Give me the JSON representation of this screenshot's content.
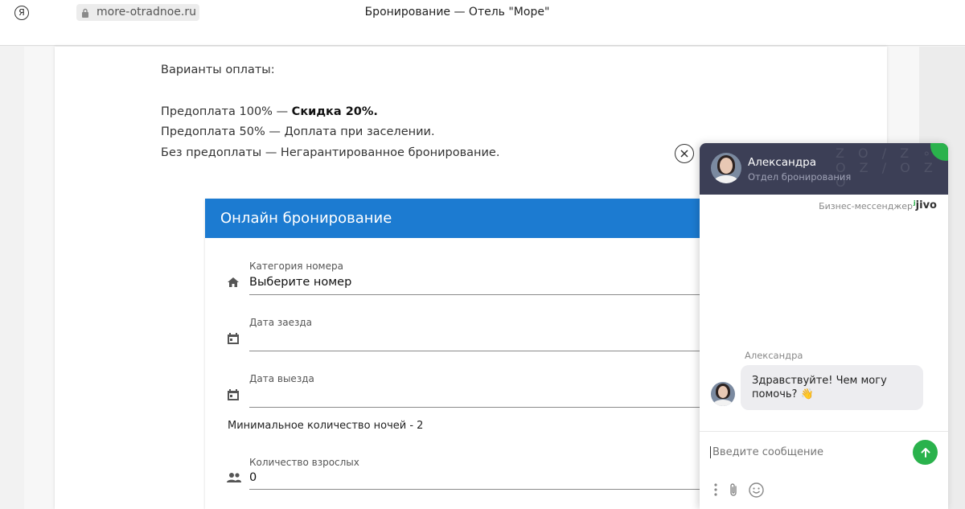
{
  "browser": {
    "logo": "Я",
    "url": "more-otradnoe.ru",
    "title": "Бронирование — Отель \"Море\""
  },
  "payment": {
    "heading": "Варианты оплаты:",
    "line1_prefix": "Предоплата 100% — ",
    "line1_bold": "Скидка 20%.",
    "line2": "Предоплата 50% — Доплата при заселении.",
    "line3": "Без предоплаты — Негарантированное бронирование."
  },
  "booking": {
    "title": "Онлайн бронирование",
    "room_label": "Категория номера",
    "room_value": "Выберите номер",
    "checkin_label": "Дата заезда",
    "checkin_value": "",
    "checkout_label": "Дата выезда",
    "checkout_value": "",
    "min_nights": "Минимальное количество ночей - 2",
    "adults_label": "Количество взрослых",
    "adults_value": "0"
  },
  "chat": {
    "agent_name": "Александра",
    "agent_dept": "Отдел бронирования",
    "powered_label": "Бизнес-мессенджер",
    "brand": "jivo",
    "message_author": "Александра",
    "message_text": "Здравствуйте! Чем могу помочь?",
    "message_emoji": "👋",
    "input_placeholder": "Введите сообщение",
    "header_color": "#3c3f56",
    "accent_color": "#2ab24c"
  },
  "colors": {
    "booking_header": "#1c7bd1"
  },
  "icons": {
    "close": "close-icon",
    "room": "home-icon",
    "checkin": "calendar-icon",
    "checkout": "calendar-icon",
    "adults": "people-icon",
    "send": "arrow-up-icon",
    "more": "more-vertical-icon",
    "attach": "paperclip-icon",
    "emoji": "smiley-icon"
  }
}
